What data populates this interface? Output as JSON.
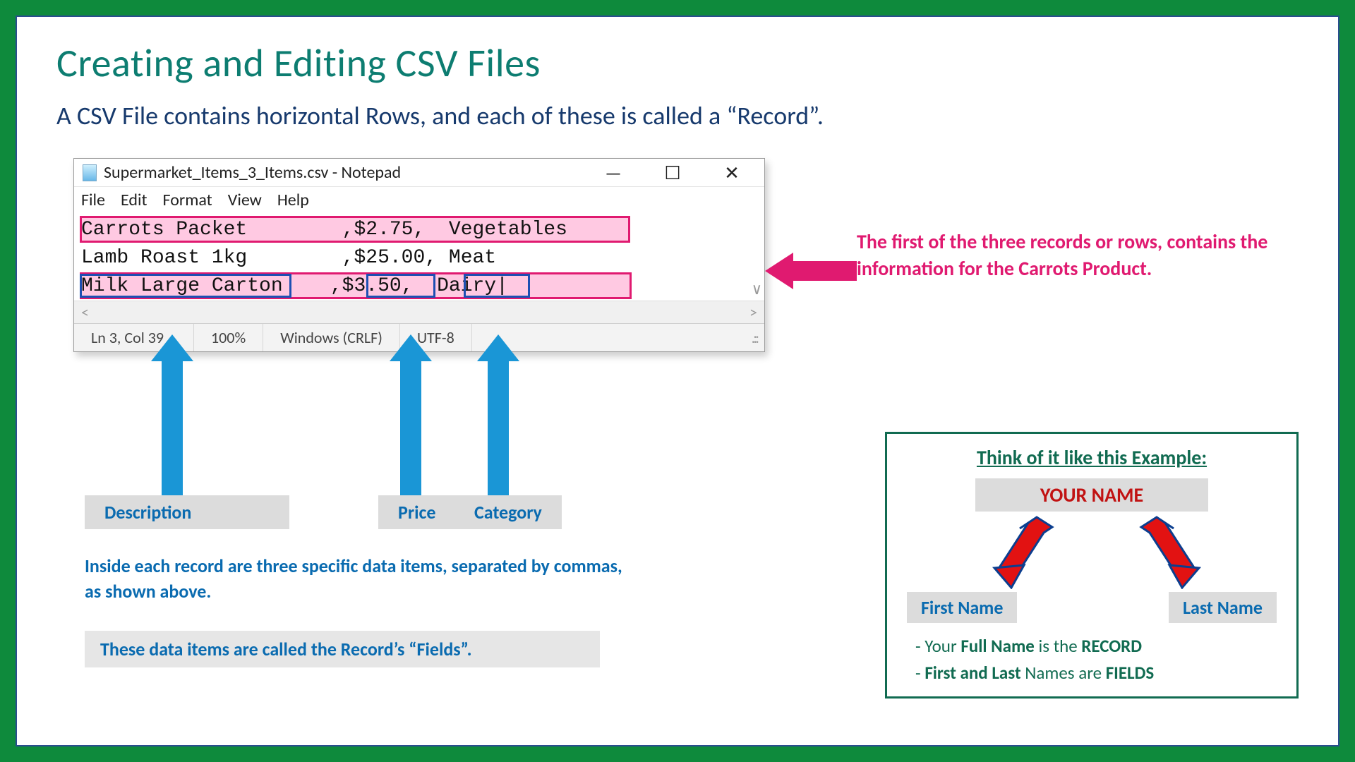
{
  "title": "Creating and Editing CSV Files",
  "subhead": "A CSV File contains horizontal Rows, and each of these is called a “Record”.",
  "notepad": {
    "window_title": "Supermarket_Items_3_Items.csv - Notepad",
    "btn_min": "—",
    "btn_max": "☐",
    "btn_close": "✕",
    "menu": {
      "file": "File",
      "edit": "Edit",
      "format": "Format",
      "view": "View",
      "help": "Help"
    },
    "lines": {
      "l1": "Carrots Packet        ,$2.75,  Vegetables",
      "l2": "Lamb Roast 1kg        ,$25.00, Meat",
      "l3": "Milk Large Carton    ,$3.50,  Dairy|"
    },
    "hscroll_left": "<",
    "hscroll_right": ">",
    "scroll_v": "∨",
    "status": {
      "pos": "Ln 3, Col 39",
      "zoom": "100%",
      "eol": "Windows (CRLF)",
      "enc": "UTF-8",
      "grip": ".::"
    }
  },
  "field_labels": {
    "desc": "Description",
    "price": "Price",
    "cat": "Category"
  },
  "blue_para": "Inside each record are three specific data items, separated by commas, as shown above.",
  "fields_callout": "These data items are called the Record’s “Fields”.",
  "pink_note": "The first of the three records or rows, contains the information for the Carrots Product.",
  "example": {
    "title": "Think of it like this Example:",
    "your_name": "YOUR NAME",
    "first": "First Name",
    "last": "Last Name",
    "line1_a": "- Your ",
    "line1_b": "Full Name",
    "line1_c": " is the ",
    "line1_d": "RECORD",
    "line2_a": "- ",
    "line2_b": "First and Last",
    "line2_c": " Names are ",
    "line2_d": "FIELDS"
  }
}
